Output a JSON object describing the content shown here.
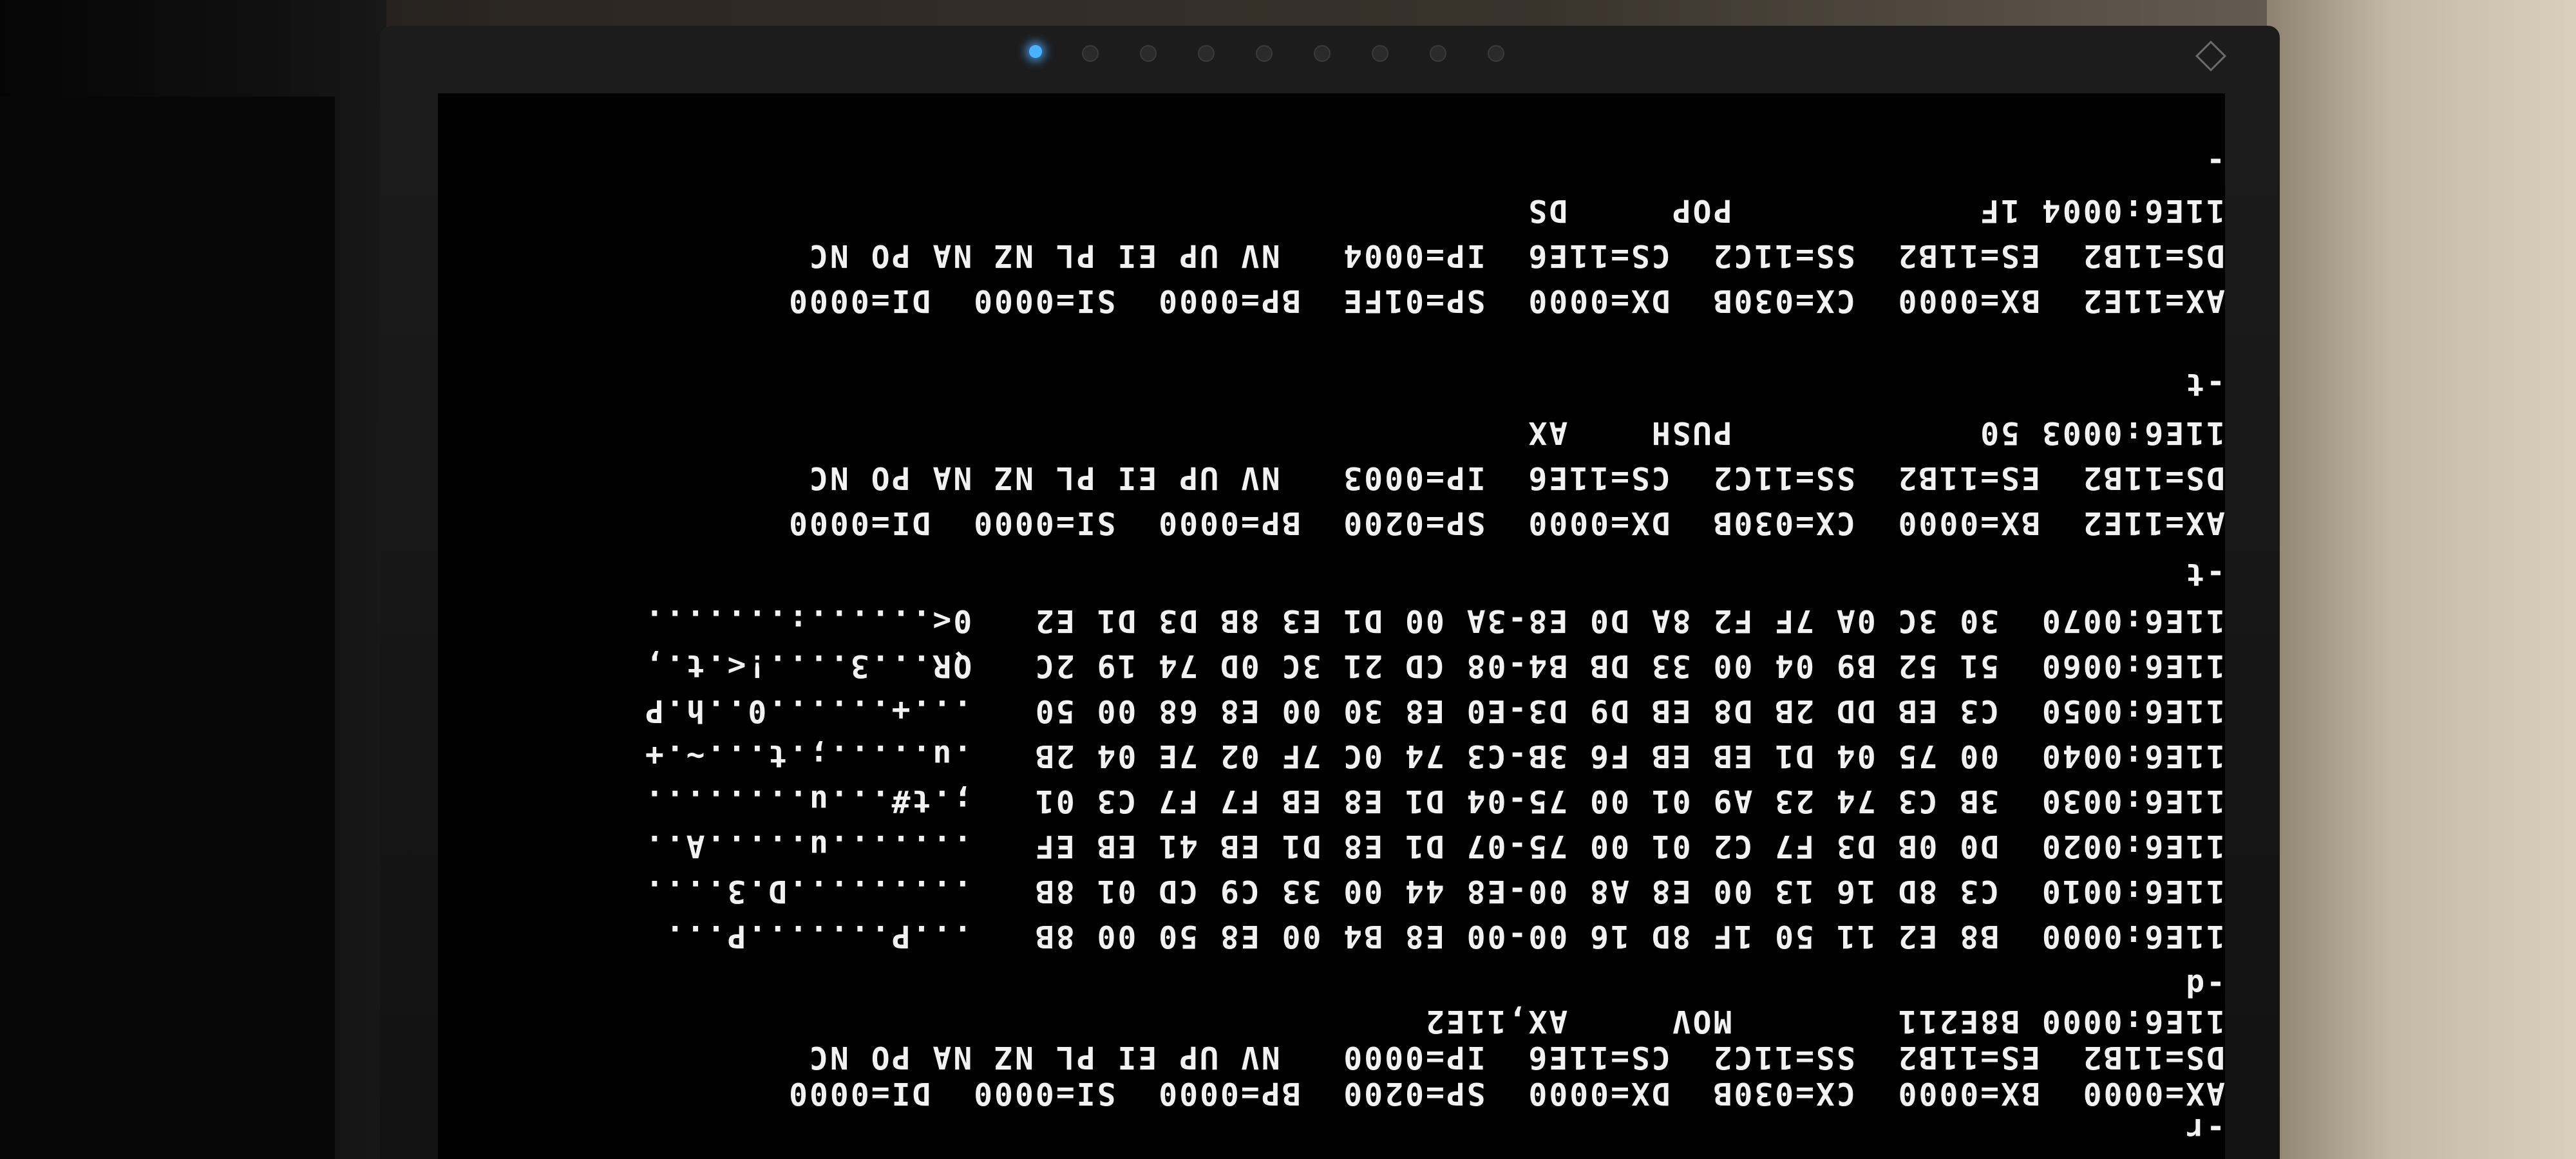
{
  "terminal": {
    "lines": [
      "-r",
      "AX=0000  BX=0000  CX=030B  DX=0000  SP=0200  BP=0000  SI=0000  DI=0000",
      "DS=11B2  ES=11B2  SS=11C2  CS=11E6  IP=0000   NV UP EI PL NZ NA PO NC",
      "11E6:0000 B8E211        MOV     AX,11E2",
      "-d",
      "11E6:0000  B8 E2 11 50 1F 8D 16 00-00 E8 B4 00 E8 50 00 8B   ...P.......P...",
      "11E6:0010  C3 8D 16 13 00 E8 A8 00-E8 44 00 33 C9 CD 01 8B   .........D.3....",
      "11E6:0020  D0 0B D3 F7 C2 01 00 75-07 D1 E8 D1 EB 41 EB EF   .......u.....A..",
      "11E6:0030  3B C3 74 23 A9 01 00 75-04 D1 E8 EB F7 F7 C3 01   ;.t#...u........",
      "11E6:0040  00 75 04 D1 EB EB F6 3B-C3 74 0C 7F 02 7E 04 2B   .u.....;.t...~.+",
      "11E6:0050  C3 EB DD 2B D8 EB D9 D3-E0 E8 30 00 E8 68 00 50   ...+......0..h.P",
      "11E6:0060  51 52 B9 04 00 33 DB B4-08 CD 21 3C 0D 74 19 2C   QR...3....!<.t.,",
      "11E6:0070  30 3C 0A 7F F2 8A D0 E8-3A 00 D1 E3 8B D3 D1 E2   0<......:.......",
      "-t",
      "AX=11E2  BX=0000  CX=030B  DX=0000  SP=0200  BP=0000  SI=0000  DI=0000",
      "DS=11B2  ES=11B2  SS=11C2  CS=11E6  IP=0003   NV UP EI PL NZ NA PO NC",
      "11E6:0003 50            PUSH    AX",
      "-t",
      "AX=11E2  BX=0000  CX=030B  DX=0000  SP=01FE  BP=0000  SI=0000  DI=0000",
      "DS=11B2  ES=11B2  SS=11C2  CS=11E6  IP=0004   NV UP EI PL NZ NA PO NC",
      "11E6:0004 1F            POP     DS",
      "-"
    ]
  },
  "colors": {
    "screen_bg": "#000000",
    "text": "#f2f2f2",
    "led": "#4ab3ff"
  }
}
